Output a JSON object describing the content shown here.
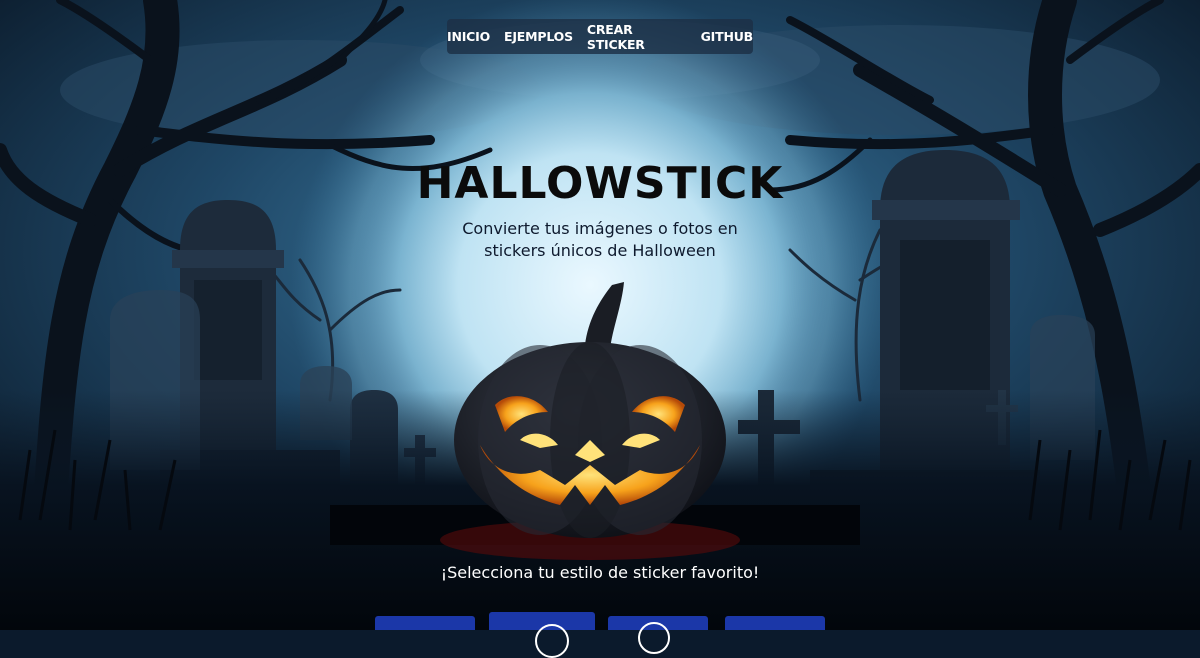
{
  "nav": {
    "items": [
      "INICIO",
      "EJEMPLOS",
      "CREAR STICKER",
      "GITHUB"
    ]
  },
  "hero": {
    "title": "HALLOWSTICK",
    "subtitle_line1": "Convierte tus imágenes o fotos en",
    "subtitle_line2": "stickers únicos de Halloween"
  },
  "cta": {
    "text": "¡Selecciona tu estilo de sticker favorito!"
  },
  "style_buttons": [
    {
      "name": "style-option-1",
      "icon": "none"
    },
    {
      "name": "style-option-2",
      "icon": "circle-icon"
    },
    {
      "name": "style-option-3",
      "icon": "circle-icon"
    },
    {
      "name": "style-option-4",
      "icon": "none"
    }
  ],
  "colors": {
    "accent": "#1b37a8",
    "moon": "#cfeaf6",
    "pumpkin_glow": "#f7a21b",
    "night_sky": "#1d3c5a",
    "nav_bg": "#1c3046"
  }
}
